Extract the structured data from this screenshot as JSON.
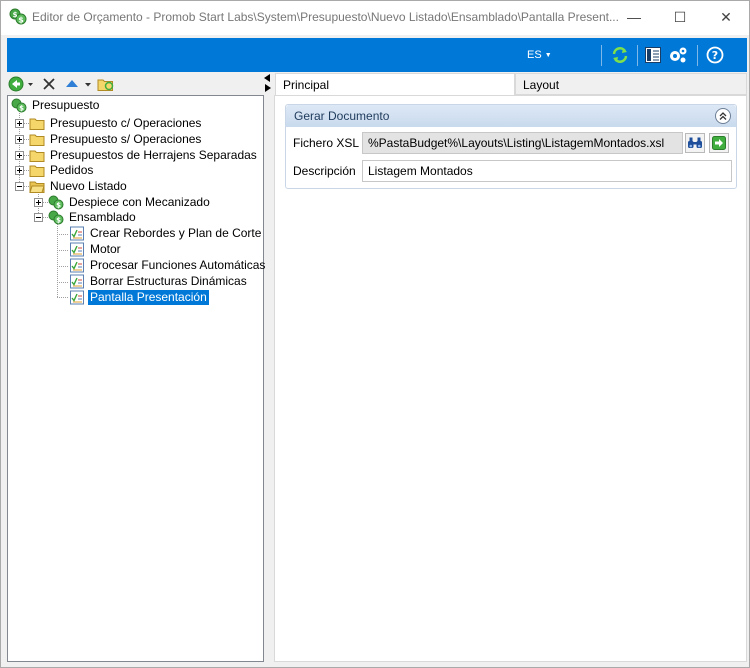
{
  "window": {
    "title": "Editor de Orçamento - Promob Start Labs\\System\\Presupuesto\\Nuevo Listado\\Ensamblado\\Pantalla Present...",
    "app_icon": "budget-dollar-icon",
    "controls": {
      "minimize": "—",
      "maximize": "☐",
      "close": "✕"
    }
  },
  "toolbar": {
    "language": "ES",
    "buttons": [
      "refresh-icon",
      "layout-panel-icon",
      "settings-gears-icon",
      "help-icon"
    ]
  },
  "left_toolbar": {
    "buttons": [
      "back-icon",
      "delete-icon",
      "move-up-icon",
      "folder-refresh-icon"
    ]
  },
  "tree": {
    "nodes": [
      {
        "label": "Presupuesto",
        "icon": "budget-dollar-icon"
      },
      {
        "label": "Presupuesto c/ Operaciones",
        "icon": "folder-icon"
      },
      {
        "label": "Presupuesto s/ Operaciones",
        "icon": "folder-icon"
      },
      {
        "label": "Presupuestos de Herrajens Separadas",
        "icon": "folder-icon"
      },
      {
        "label": "Pedidos",
        "icon": "folder-icon"
      },
      {
        "label": "Nuevo Listado",
        "icon": "folder-open-icon"
      },
      {
        "label": "Despiece con Mecanizado",
        "icon": "budget-dollar-icon"
      },
      {
        "label": "Ensamblado",
        "icon": "budget-dollar-icon"
      },
      {
        "label": "Crear Rebordes y Plan de Corte",
        "icon": "checklist-icon"
      },
      {
        "label": "Motor",
        "icon": "checklist-icon"
      },
      {
        "label": "Procesar Funciones Automáticas",
        "icon": "checklist-icon"
      },
      {
        "label": "Borrar Estructuras Dinámicas",
        "icon": "checklist-icon"
      },
      {
        "label": "Pantalla Presentación",
        "icon": "checklist-icon",
        "selected": true
      }
    ]
  },
  "tabs": [
    {
      "label": "Principal",
      "active": true
    },
    {
      "label": "Layout",
      "active": false
    }
  ],
  "group": {
    "title": "Gerar Documento",
    "fields": {
      "xsl_label": "Fichero XSL",
      "xsl_value": "%PastaBudget%\\Layouts\\Listing\\ListagemMontados.xsl",
      "desc_label": "Descripción",
      "desc_value": "Listagem Montados"
    }
  },
  "colors": {
    "accent": "#0078d7",
    "group_header": "#c9daee",
    "folder": "#f5d66b",
    "money_green": "#3a9a3a"
  }
}
